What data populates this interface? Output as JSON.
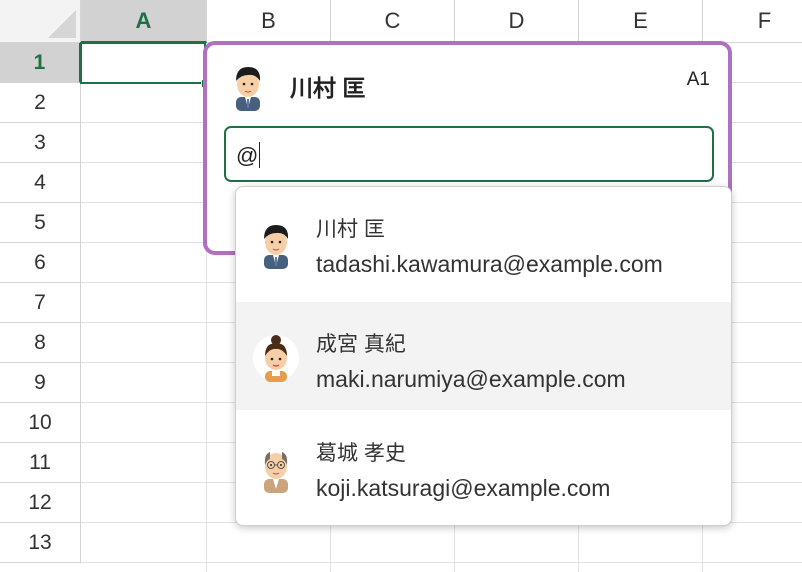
{
  "sheet": {
    "columns": [
      "A",
      "B",
      "C",
      "D",
      "E",
      "F"
    ],
    "rows": [
      "1",
      "2",
      "3",
      "4",
      "5",
      "6",
      "7",
      "8",
      "9",
      "10",
      "11",
      "12",
      "13"
    ],
    "selected_column": "A",
    "selected_row": "1"
  },
  "comment": {
    "author": "川村 匡",
    "cell_ref": "A1",
    "input_value": "@"
  },
  "mention_suggestions": [
    {
      "name": "川村 匡",
      "email": "tadashi.kawamura@example.com",
      "avatar": "man-dark-hair-avatar"
    },
    {
      "name": "成宮 真紀",
      "email": "maki.narumiya@example.com",
      "avatar": "woman-bun-avatar"
    },
    {
      "name": "葛城 孝史",
      "email": "koji.katsuragi@example.com",
      "avatar": "older-man-glasses-avatar"
    }
  ],
  "colors": {
    "accent_green": "#1e7145",
    "comment_border": "#b06fc0"
  }
}
